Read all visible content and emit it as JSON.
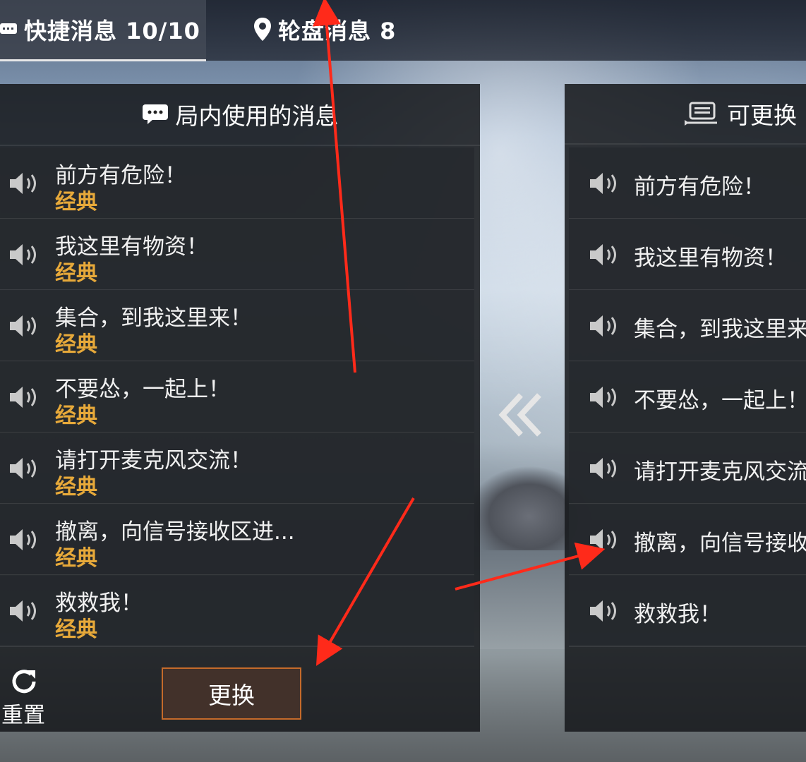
{
  "tabs": [
    {
      "label": "快捷消息 10/10",
      "icon": "chat-icon",
      "active": true
    },
    {
      "label": "轮盘消息 8",
      "icon": "location-pin-icon",
      "active": false
    }
  ],
  "left_panel": {
    "title": "局内使用的消息",
    "icon": "chat-bubble-icon",
    "items": [
      {
        "text": "前方有危险！",
        "tag": "经典"
      },
      {
        "text": "我这里有物资！",
        "tag": "经典"
      },
      {
        "text": "集合，到我这里来！",
        "tag": "经典"
      },
      {
        "text": "不要怂，一起上！",
        "tag": "经典"
      },
      {
        "text": "请打开麦克风交流！",
        "tag": "经典"
      },
      {
        "text": "撤离，向信号接收区进...",
        "tag": "经典"
      },
      {
        "text": "救救我！",
        "tag": "经典"
      }
    ]
  },
  "right_panel": {
    "title": "可更换",
    "icon": "message-stack-icon",
    "items": [
      {
        "text": "前方有危险！"
      },
      {
        "text": "我这里有物资！"
      },
      {
        "text": "集合，到我这里来"
      },
      {
        "text": "不要怂，一起上！"
      },
      {
        "text": "请打开麦克风交流"
      },
      {
        "text": "撤离，向信号接收"
      },
      {
        "text": "救救我！"
      }
    ]
  },
  "controls": {
    "reset_label": "重置",
    "replace_label": "更换"
  },
  "colors": {
    "accent_tag": "#e7a93a",
    "button_border": "#c56a2a",
    "annotation_arrow": "#ff2a1a"
  }
}
